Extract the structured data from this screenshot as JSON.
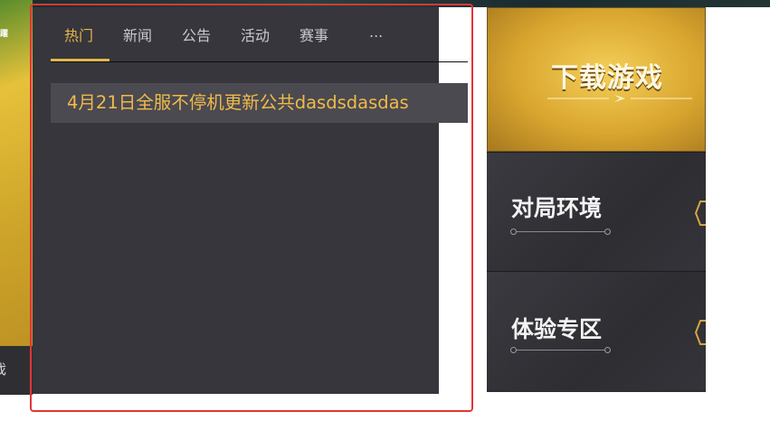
{
  "left_banner": {
    "logo_fragment": "躍",
    "cut_text": "戏"
  },
  "news": {
    "tabs": [
      {
        "label": "热门",
        "active": true
      },
      {
        "label": "新闻",
        "active": false
      },
      {
        "label": "公告",
        "active": false
      },
      {
        "label": "活动",
        "active": false
      },
      {
        "label": "赛事",
        "active": false
      },
      {
        "label": "...",
        "active": false
      }
    ],
    "items": [
      {
        "title": "4月21日全服不停机更新公共dasdsdasdas"
      }
    ]
  },
  "side_menu": {
    "download_label": "下载游戏",
    "cards": [
      {
        "label": "对局环境"
      },
      {
        "label": "体验专区"
      }
    ]
  },
  "colors": {
    "accent": "#e6b54a",
    "panel": "#36363c",
    "highlight_border": "#e23636"
  }
}
